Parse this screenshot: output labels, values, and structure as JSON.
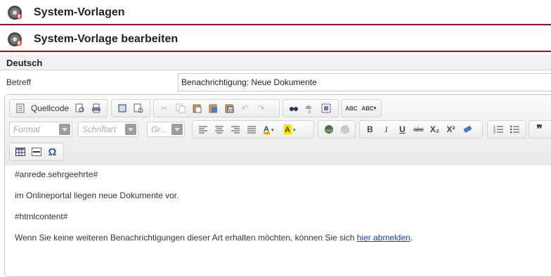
{
  "header1": {
    "title": "System-Vorlagen"
  },
  "header2": {
    "title": "System-Vorlage bearbeiten"
  },
  "language": "Deutsch",
  "subject": {
    "label": "Betreff",
    "value": "Benachrichtigung: Neue Dokumente"
  },
  "toolbar": {
    "source_label": "Quellcode",
    "format_placeholder": "Format",
    "font_placeholder": "Schriftart",
    "size_placeholder": "Gr...",
    "bold": "B",
    "italic": "I",
    "underline": "U",
    "strike": "abc",
    "subscript": "X₂",
    "superscript": "X²",
    "spell1": "ABC",
    "spell2": "ABC",
    "blockquote": "❞",
    "special_char": "Ω"
  },
  "content": {
    "line1": "#anrede.sehrgeehrte#",
    "line2": "im Onlineportal liegen neue Dokumente vor.",
    "line3": "#htmlcontent#",
    "line4_text": "Wenn Sie keine weiteren Benachrichtigungen dieser Art erhalten möchten, können Sie sich ",
    "line4_link": "hier abmelden",
    "line4_end": "."
  },
  "colors": {
    "accent": "#8b1a1a",
    "link": "#1a3fa8"
  }
}
